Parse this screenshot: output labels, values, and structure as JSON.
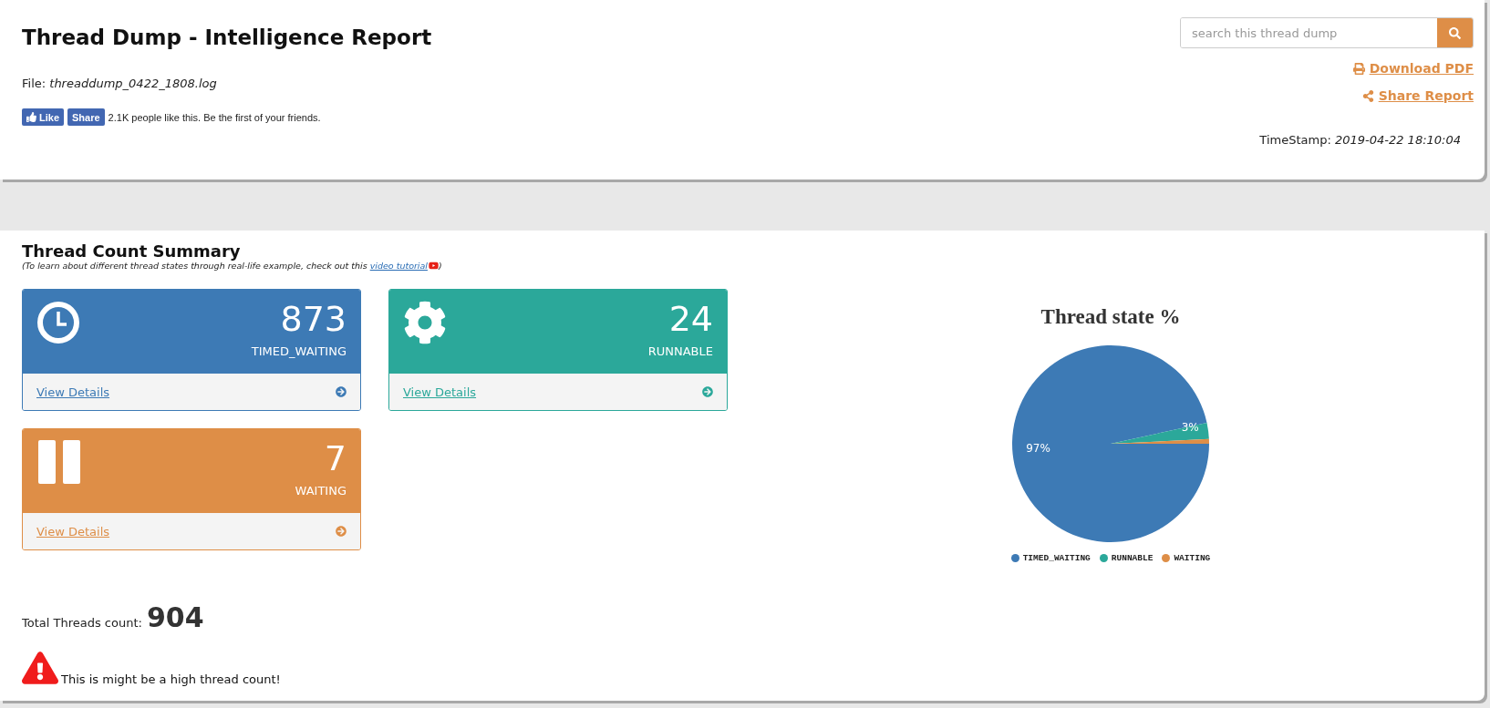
{
  "header": {
    "title": "Thread Dump - Intelligence Report",
    "file_label": "File:",
    "file_name": "threaddump_0422_1808.log",
    "social": {
      "like": "Like",
      "share": "Share",
      "text": "2.1K people like this. Be the first of your friends."
    },
    "search": {
      "placeholder": "search this thread dump"
    },
    "links": [
      "Download PDF",
      "Share Report"
    ],
    "timestamp_label": "TimeStamp:",
    "timestamp": "2019-04-22 18:10:04"
  },
  "summary": {
    "title": "Thread Count Summary",
    "note_before": "(To learn about different thread states through real-life example, check out this ",
    "note_link": "video tutorial",
    "note_after": ")",
    "cards": [
      {
        "kind": "clock",
        "count": "873",
        "state": "TIMED_WAITING",
        "link": "View Details",
        "color": "#3d7ab5"
      },
      {
        "kind": "gear",
        "count": "24",
        "state": "RUNNABLE",
        "link": "View Details",
        "color": "#2ba89a"
      },
      {
        "kind": "pause",
        "count": "7",
        "state": "WAITING",
        "link": "View Details",
        "color": "#de8e47"
      }
    ],
    "total_label": "Total Threads count:",
    "total": "904",
    "warning": "This is might be a high thread count!",
    "chart_data": {
      "type": "pie",
      "title": "Thread state %",
      "categories": [
        "TIMED_WAITING",
        "RUNNABLE",
        "WAITING"
      ],
      "values": [
        96.57,
        2.66,
        0.77
      ],
      "value_labels": [
        "97%",
        "3%",
        null
      ]
    }
  }
}
